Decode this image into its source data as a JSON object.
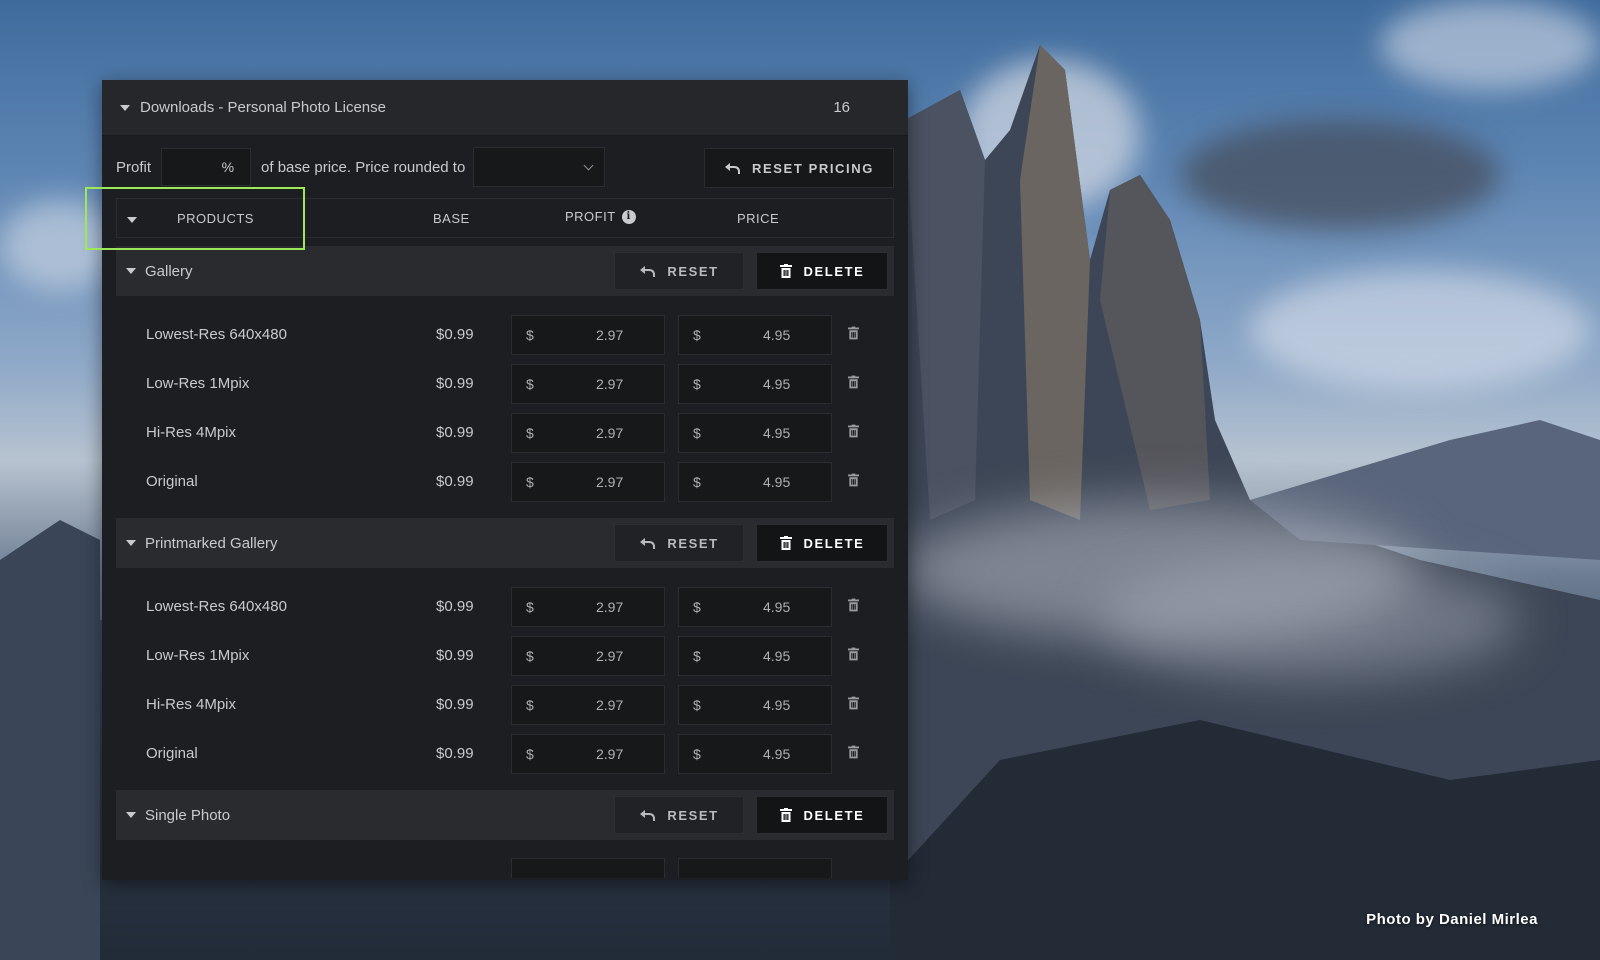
{
  "panel": {
    "title": "Downloads - Personal Photo License",
    "count": "16"
  },
  "profit_row": {
    "label": "Profit",
    "percent_symbol": "%",
    "percent_value": "",
    "text_after": "of base price. Price rounded to",
    "rounding_value": "",
    "reset_pricing_label": "RESET PRICING"
  },
  "columns": {
    "products": "PRODUCTS",
    "base": "BASE",
    "profit": "PROFIT",
    "price": "PRICE",
    "info_glyph": "i"
  },
  "buttons": {
    "reset": "RESET",
    "delete": "DELETE"
  },
  "groups": [
    {
      "name": "Gallery",
      "rows": [
        {
          "name": "Lowest-Res 640x480",
          "base": "$0.99",
          "currency": "$",
          "profit": "2.97",
          "price": "4.95"
        },
        {
          "name": "Low-Res 1Mpix",
          "base": "$0.99",
          "currency": "$",
          "profit": "2.97",
          "price": "4.95"
        },
        {
          "name": "Hi-Res 4Mpix",
          "base": "$0.99",
          "currency": "$",
          "profit": "2.97",
          "price": "4.95"
        },
        {
          "name": "Original",
          "base": "$0.99",
          "currency": "$",
          "profit": "2.97",
          "price": "4.95"
        }
      ]
    },
    {
      "name": "Printmarked Gallery",
      "rows": [
        {
          "name": "Lowest-Res 640x480",
          "base": "$0.99",
          "currency": "$",
          "profit": "2.97",
          "price": "4.95"
        },
        {
          "name": "Low-Res 1Mpix",
          "base": "$0.99",
          "currency": "$",
          "profit": "2.97",
          "price": "4.95"
        },
        {
          "name": "Hi-Res 4Mpix",
          "base": "$0.99",
          "currency": "$",
          "profit": "2.97",
          "price": "4.95"
        },
        {
          "name": "Original",
          "base": "$0.99",
          "currency": "$",
          "profit": "2.97",
          "price": "4.95"
        }
      ]
    },
    {
      "name": "Single Photo",
      "rows": []
    }
  ],
  "photo_credit": "Photo by Daniel Mirlea",
  "colors": {
    "panel_bg": "#1d1e21",
    "highlight": "#9ce85a",
    "group_header_bg": "#2a2b2f"
  }
}
